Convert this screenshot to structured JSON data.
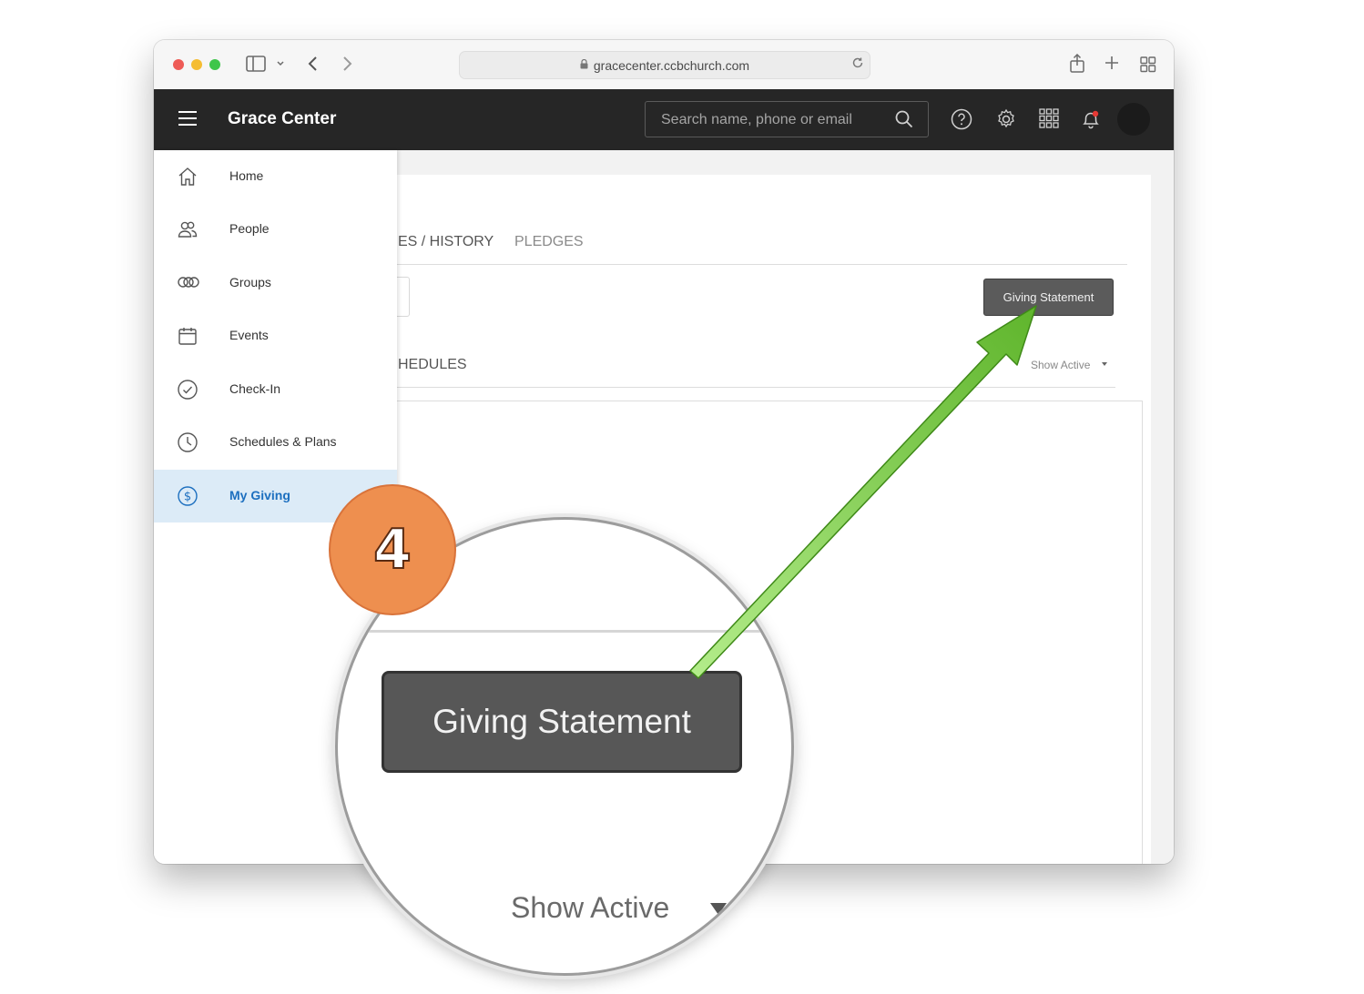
{
  "browser": {
    "url": "gracecenter.ccbchurch.com"
  },
  "header": {
    "title": "Grace Center",
    "search_placeholder": "Search name, phone or email"
  },
  "sidebar": {
    "items": [
      {
        "label": "Home",
        "icon": "home-icon"
      },
      {
        "label": "People",
        "icon": "people-icon"
      },
      {
        "label": "Groups",
        "icon": "groups-icon"
      },
      {
        "label": "Events",
        "icon": "calendar-icon"
      },
      {
        "label": "Check-In",
        "icon": "check-circle-icon"
      },
      {
        "label": "Schedules & Plans",
        "icon": "clock-icon"
      },
      {
        "label": "My Giving",
        "icon": "dollar-circle-icon",
        "active": true
      }
    ]
  },
  "main": {
    "tabs": [
      {
        "label": "ES / HISTORY"
      },
      {
        "label": "PLEDGES"
      }
    ],
    "giving_statement_label": "Giving Statement",
    "schedules_label": "HEDULES",
    "filter_label": "Show Active"
  },
  "overlay": {
    "step_number": "4",
    "zoom_button_label": "Giving Statement",
    "zoom_filter_label": "Show Active"
  },
  "colors": {
    "header_bg": "#262626",
    "active_nav_bg": "#dcebf7",
    "active_nav_text": "#1c6fbf",
    "button_bg": "#5b5b5b",
    "badge": "#ee8f4f",
    "arrow": "#6cbe3a"
  }
}
